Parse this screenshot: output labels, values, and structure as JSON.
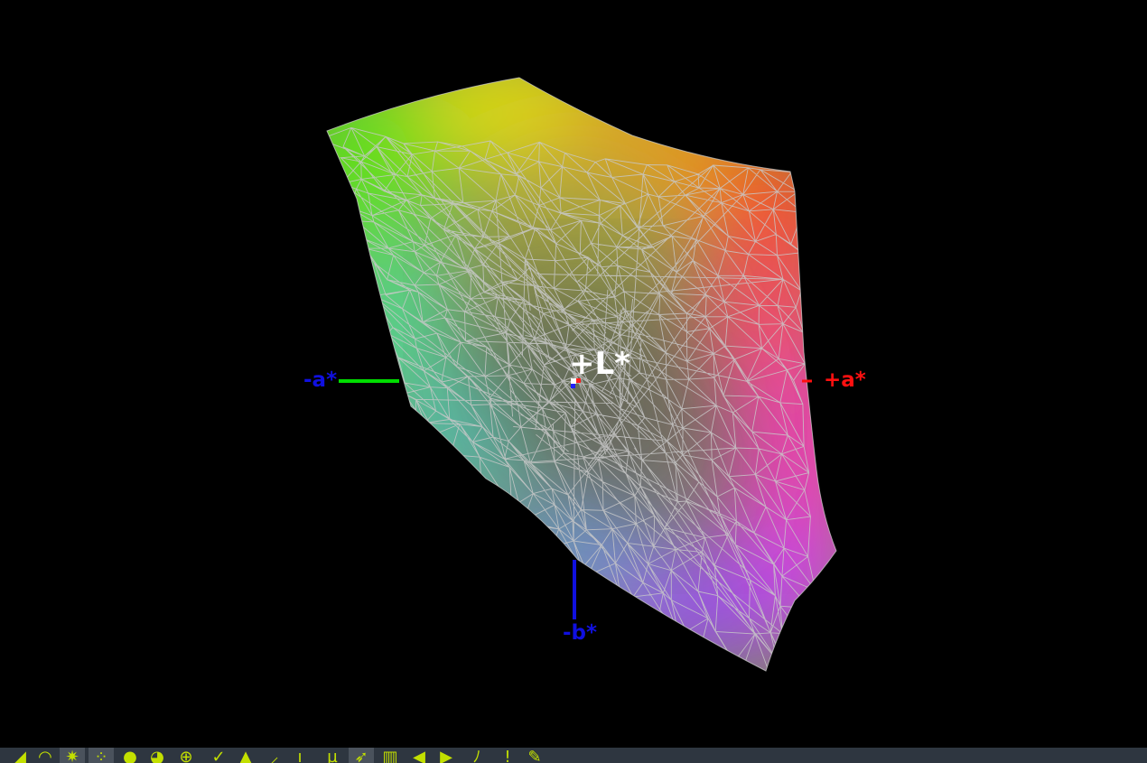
{
  "viewer": {
    "axis_labels": {
      "neg_a": "-a*",
      "pos_a": "+a*",
      "neg_b": "-b*",
      "pos_l": "+L*"
    },
    "colors": {
      "background": "#000000",
      "neg_a_axis": "#00dd00",
      "pos_a_axis": "#ff1010",
      "neg_b_axis": "#1010e0",
      "pos_l_axis": "#ffffff",
      "wireframe": "#c8c8c8",
      "toolbar_bg": "#2e3640",
      "toolbar_icon": "#c3e000"
    }
  },
  "toolbar": {
    "buttons": [
      {
        "icon": "pointer-icon",
        "glyph": "◢",
        "active": false
      },
      {
        "icon": "arc-icon",
        "glyph": "◠",
        "active": false
      },
      {
        "icon": "spark-icon",
        "glyph": "✷",
        "active": true
      },
      {
        "icon": "dots-icon",
        "glyph": "⁘",
        "active": true
      },
      {
        "icon": "solid-sphere-icon",
        "glyph": "●",
        "active": false
      },
      {
        "icon": "half-sphere-icon",
        "glyph": "◕",
        "active": false
      },
      {
        "icon": "target-icon",
        "glyph": "⊕",
        "active": false
      },
      {
        "icon": "check-icon",
        "glyph": "✓",
        "active": false
      },
      {
        "icon": "triangle-up-icon",
        "glyph": "▲",
        "active": false
      },
      {
        "icon": "small-check-icon",
        "glyph": "⸝",
        "active": false
      },
      {
        "icon": "tick-icon",
        "glyph": "ı",
        "active": false
      },
      {
        "icon": "mu-icon",
        "glyph": "µ",
        "active": false
      },
      {
        "icon": "arrow-icon",
        "glyph": "➶",
        "active": true
      },
      {
        "icon": "grid-icon",
        "glyph": "▥",
        "active": false
      },
      {
        "icon": "play-back-icon",
        "glyph": "◀",
        "active": false
      },
      {
        "icon": "play-forward-icon",
        "glyph": "▶",
        "active": false
      },
      {
        "icon": "swirl-icon",
        "glyph": "ﾉ",
        "active": false
      },
      {
        "icon": "exclamation-icon",
        "glyph": "!",
        "active": false
      },
      {
        "icon": "pen-icon",
        "glyph": "✎",
        "active": false
      }
    ]
  }
}
